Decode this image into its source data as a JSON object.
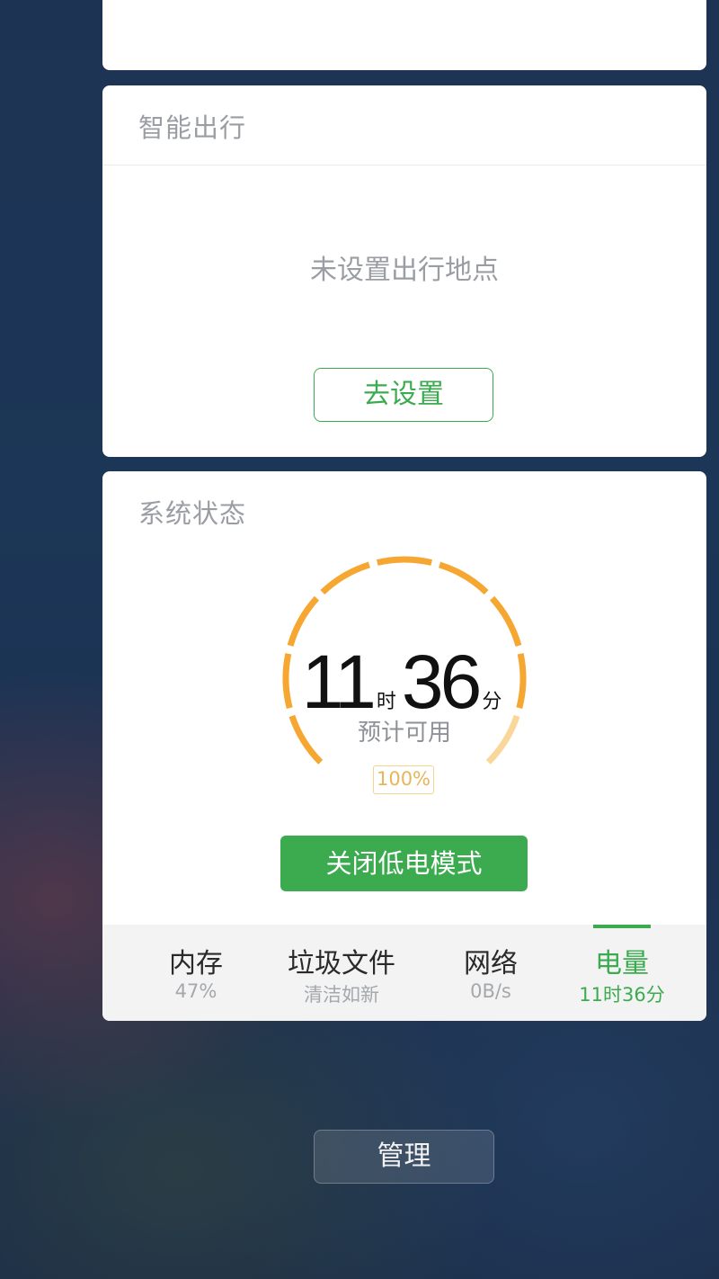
{
  "travel_card": {
    "title": "智能出行",
    "empty_message": "未设置出行地点",
    "setup_button": "去设置"
  },
  "system_card": {
    "title": "系统状态",
    "gauge": {
      "hours": "11",
      "hours_unit": "时",
      "minutes": "36",
      "minutes_unit": "分",
      "subtitle": "预计可用",
      "percent_label": "100%",
      "level": 1.0,
      "color_filled": "#f5a731",
      "color_light": "#f9d79b"
    },
    "low_power_button": "关闭低电模式",
    "tabs": [
      {
        "label": "内存",
        "value": "47%"
      },
      {
        "label": "垃圾文件",
        "value": "清洁如新"
      },
      {
        "label": "网络",
        "value": "0B/s"
      },
      {
        "label": "电量",
        "value": "11时36分",
        "active": true
      }
    ]
  },
  "manage_button": "管理",
  "colors": {
    "accent_green": "#3cab50",
    "gauge_orange": "#f5a731"
  }
}
